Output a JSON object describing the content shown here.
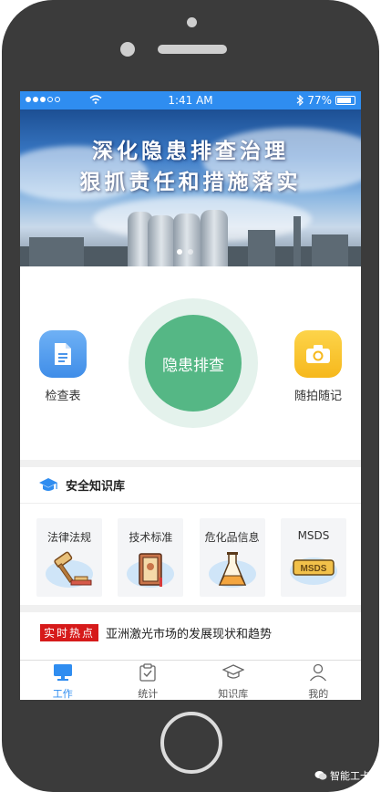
{
  "status_bar": {
    "time": "1:41 AM",
    "battery": "77%"
  },
  "banner": {
    "line1": "深化隐患排查治理",
    "line2": "狠抓责任和措施落实"
  },
  "actions": {
    "left_label": "检查表",
    "main_label": "隐患排查",
    "right_label": "随拍随记"
  },
  "knowledge": {
    "title": "安全知识库",
    "items": [
      {
        "label": "法律法规",
        "icon": "gavel-icon"
      },
      {
        "label": "技术标准",
        "icon": "book-icon"
      },
      {
        "label": "危化品信息",
        "icon": "flask-icon"
      },
      {
        "label": "MSDS",
        "icon": "msds-icon",
        "badge": "MSDS"
      }
    ]
  },
  "news": {
    "tag": "实时热点",
    "headline": "亚洲激光市场的发展现状和趋势"
  },
  "tabs": [
    {
      "label": "工作",
      "icon": "monitor-icon",
      "active": true
    },
    {
      "label": "统计",
      "icon": "clipboard-icon",
      "active": false
    },
    {
      "label": "知识库",
      "icon": "graduation-cap-icon",
      "active": false
    },
    {
      "label": "我的",
      "icon": "user-icon",
      "active": false
    }
  ],
  "watermark": "智能工卡",
  "colors": {
    "accent": "#2f8df0",
    "primary_green": "#55b785",
    "hot_red": "#d61a1a",
    "camera_yellow": "#f8c22b"
  }
}
